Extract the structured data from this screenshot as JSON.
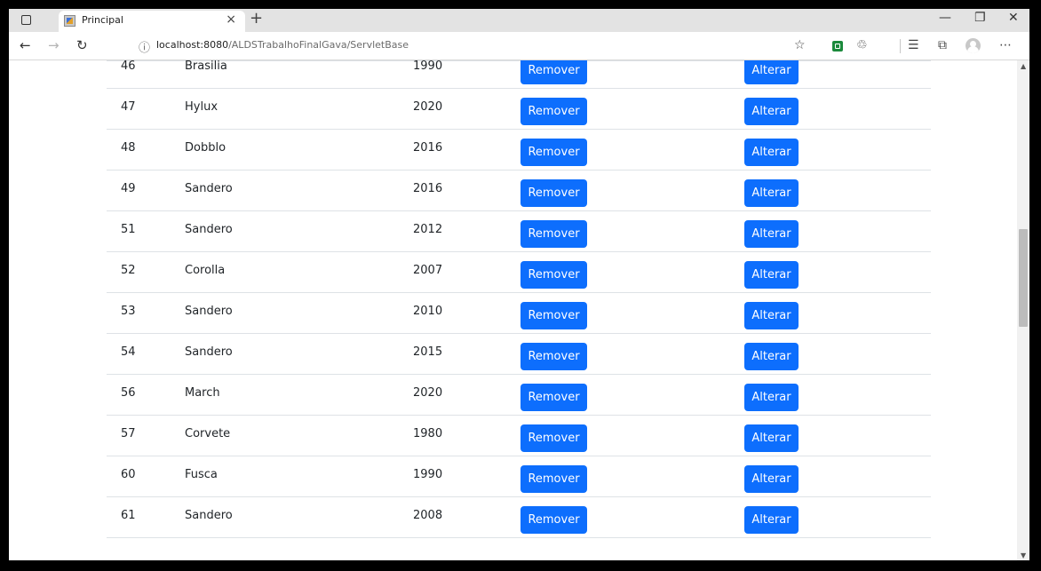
{
  "browser": {
    "tab_title": "Principal",
    "tab_close": "×",
    "new_tab": "+",
    "minimize": "—",
    "restore": "❐",
    "close": "✕",
    "url_host": "localhost:8080",
    "url_path": "/ALDSTrabalhoFinalGava/ServletBase"
  },
  "table": {
    "button_remove": "Remover",
    "button_alter": "Alterar",
    "rows": [
      {
        "id": "46",
        "name": "Brasilia",
        "year": "1990"
      },
      {
        "id": "47",
        "name": "Hylux",
        "year": "2020"
      },
      {
        "id": "48",
        "name": "Dobblo",
        "year": "2016"
      },
      {
        "id": "49",
        "name": "Sandero",
        "year": "2016"
      },
      {
        "id": "51",
        "name": "Sandero",
        "year": "2012"
      },
      {
        "id": "52",
        "name": "Corolla",
        "year": "2007"
      },
      {
        "id": "53",
        "name": "Sandero",
        "year": "2010"
      },
      {
        "id": "54",
        "name": "Sandero",
        "year": "2015"
      },
      {
        "id": "56",
        "name": "March",
        "year": "2020"
      },
      {
        "id": "57",
        "name": "Corvete",
        "year": "1980"
      },
      {
        "id": "60",
        "name": "Fusca",
        "year": "1990"
      },
      {
        "id": "61",
        "name": "Sandero",
        "year": "2008"
      }
    ]
  },
  "colors": {
    "primary_button": "#0d6efd",
    "row_border": "#dee2e6"
  }
}
